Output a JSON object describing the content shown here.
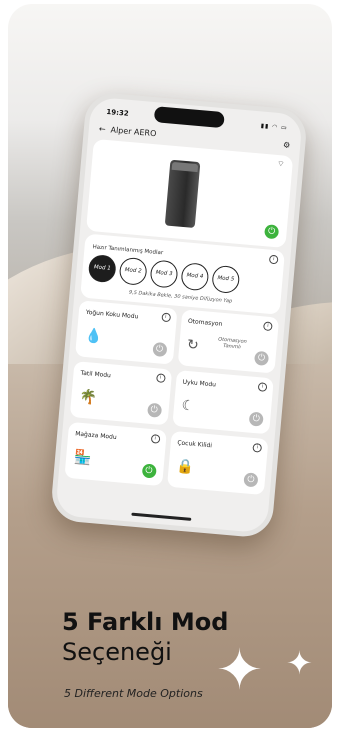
{
  "app": {
    "time": "19:32",
    "device_name": "Alper AERO",
    "presets_title": "Hazır Tanımlanmış Modlar",
    "modes": [
      "Mod 1",
      "Mod 2",
      "Mod 3",
      "Mod 4",
      "Mod 5"
    ],
    "active_mode": "Mod 1",
    "mode_note": "9,5 Dakika Bekle, 30 saniye Difüzyon Yap",
    "tiles": [
      {
        "label": "Yoğun Koku Modu",
        "sub": "",
        "icon": "drop-icon",
        "power": "off"
      },
      {
        "label": "Otomasyon",
        "sub": "Otomasyon Tanımlı",
        "icon": "cycle-icon",
        "power": "off"
      },
      {
        "label": "Tatil Modu",
        "sub": "",
        "icon": "palm-tree-icon",
        "power": "off"
      },
      {
        "label": "Uyku Modu",
        "sub": "",
        "icon": "moon-icon",
        "power": "off"
      },
      {
        "label": "Mağaza Modu",
        "sub": "",
        "icon": "store-icon",
        "power": "on"
      },
      {
        "label": "Çocuk Kilidi",
        "sub": "",
        "icon": "lock-icon",
        "power": "off"
      }
    ]
  },
  "promo": {
    "headline_bold": "5 Farklı Mod",
    "headline_regular": "Seçeneği",
    "english": "5 Different Mode Options"
  },
  "colors": {
    "power_on": "#3db33d",
    "power_off": "#b7b7b7"
  }
}
